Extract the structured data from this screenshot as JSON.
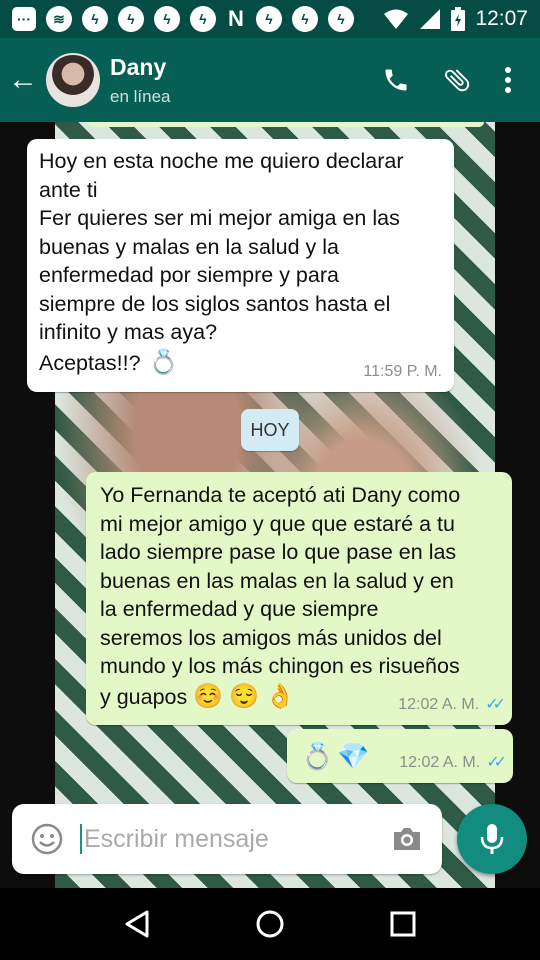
{
  "status_bar": {
    "time": "12:07",
    "icons": [
      "messages-icon",
      "spotify-icon",
      "messenger-icon",
      "messenger-icon",
      "messenger-icon",
      "messenger-icon",
      "n-app-icon",
      "messenger-icon",
      "messenger-icon",
      "messenger-icon",
      "wifi-icon",
      "signal-icon",
      "battery-icon"
    ]
  },
  "header": {
    "contact_name": "Dany",
    "contact_status": "en línea"
  },
  "messages": [
    {
      "direction": "incoming",
      "text": "Hoy en esta noche me quiero declarar\nante ti\nFer quieres ser mi mejor amiga en las\nbuenas y malas en la salud y la\nenfermedad por siempre y para\nsiempre de los siglos santos hasta el\ninfinito y mas aya?",
      "last_line": "Aceptas!!?",
      "emoji": "ring-emoji",
      "time": "11:59 P. M."
    },
    {
      "direction": "outgoing",
      "text": "Yo Fernanda te aceptó ati Dany como\nmi mejor amigo y  que que estaré a tu\nlado siempre pase lo que pase en las\nbuenas en las malas en la salud y en\nla enfermedad  y que siempre\nseremos los amigos más unidos del\nmundo y los más chingon es risueños",
      "last_line": "y guapos",
      "emojis": [
        "smiling-face-emoji",
        "relieved-face-emoji",
        "ok-hand-emoji"
      ],
      "time": "12:02 A. M.",
      "status": "read"
    },
    {
      "direction": "outgoing",
      "emojis": [
        "ring-emoji",
        "gem-emoji"
      ],
      "time": "12:02 A. M.",
      "status": "read"
    }
  ],
  "day_chip": "HOY",
  "composer": {
    "placeholder": "Escribir mensaje"
  },
  "colors": {
    "status_bar": "#054d44",
    "app_bar": "#075e54",
    "outgoing_bubble": "#e2f8c7",
    "incoming_bubble": "#ffffff",
    "fab": "#128c7e",
    "read_tick": "#4aa6e8"
  }
}
